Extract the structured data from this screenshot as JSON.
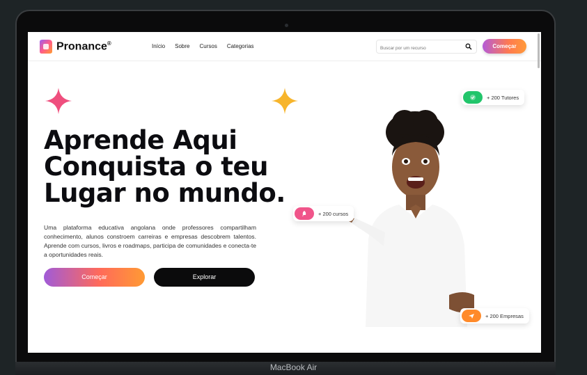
{
  "device": {
    "label": "MacBook Air"
  },
  "nav": {
    "brand": "Pronance",
    "brand_mark": "®",
    "links": [
      "Início",
      "Sobre",
      "Cursos",
      "Categorias"
    ],
    "search_placeholder": "Buscar por um recurso",
    "cta": "Começar"
  },
  "hero": {
    "title_lines": [
      "Aprende Aqui",
      "Conquista o teu",
      "Lugar no mundo."
    ],
    "description": "Uma plataforma educativa angolana onde professores compartilham conhecimento, alunos constroem carreiras e empresas descobrem talentos. Aprende com cursos, livros e roadmaps, participa de comunidades e conecta-te a oportunidades reais.",
    "primary_button": "Começar",
    "secondary_button": "Explorar"
  },
  "badges": {
    "tutores": "+ 200 Tutores",
    "cursos": "+ 200 cursos",
    "empresas": "+ 200 Empresas"
  },
  "colors": {
    "accent_pink": "#f0558a",
    "accent_orange": "#ff8a2a",
    "accent_purple": "#a05bd8",
    "accent_green": "#22c56b",
    "star_pink": "#ef4f7e",
    "star_yellow": "#f7b52c"
  }
}
